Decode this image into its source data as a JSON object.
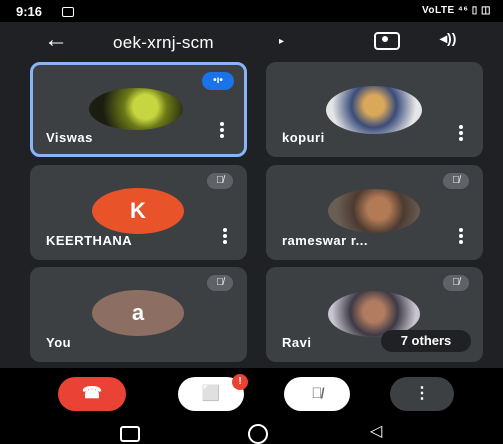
{
  "status": {
    "time": "9:16",
    "right": "VoLTE ⁴⁶ ▯ ◫"
  },
  "header": {
    "meeting_code": "oek-xrnj-scm"
  },
  "participants": [
    {
      "name": "Viswas",
      "speaking": true
    },
    {
      "name": "kopuri"
    },
    {
      "name": "KEERTHANA",
      "initial": "K",
      "mic_off": true
    },
    {
      "name": "rameswar r...",
      "mic_off": true
    },
    {
      "name": "You",
      "initial": "a",
      "mic_off": true
    },
    {
      "name": "Ravi",
      "mic_off": true
    }
  ],
  "others_chip": "7 others",
  "controls": {
    "camera_badge": "!"
  },
  "icons": {
    "back": "←",
    "caret": "▸",
    "speaker": "◂))",
    "mic_off": "🎙̸",
    "end_call": "☎",
    "camera_off": "⬜",
    "menu": "⋮"
  },
  "colors": {
    "background": "#202124",
    "tile": "#3c4043",
    "accent": "#8ab4f8",
    "end_call": "#ea4335"
  }
}
